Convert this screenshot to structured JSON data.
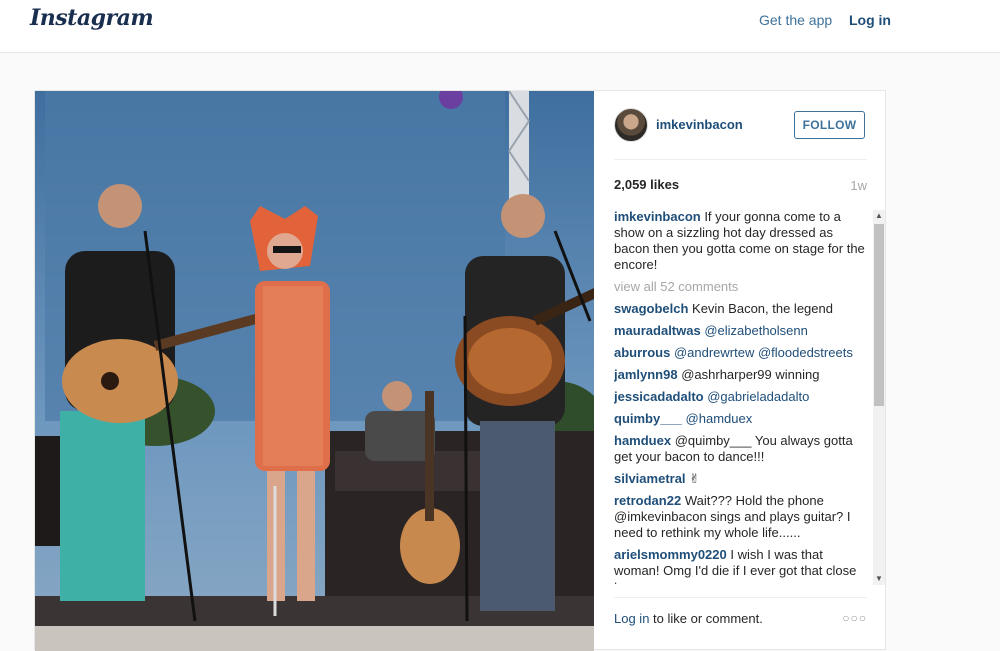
{
  "nav": {
    "logo": "Instagram",
    "get_app": "Get the app",
    "login": "Log in"
  },
  "post": {
    "username": "imkevinbacon",
    "follow_label": "FOLLOW",
    "likes": "2,059 likes",
    "time_ago": "1w",
    "caption": {
      "author": "imkevinbacon",
      "text": " If your gonna come to a show on a sizzling hot day dressed as bacon then you gotta come on stage for the encore!"
    },
    "view_all": "view all 52 comments",
    "comments": [
      {
        "author": "swagobelch",
        "text": " Kevin Bacon, the legend"
      },
      {
        "author": "mauradaltwas",
        "text": " @elizabetholsenn"
      },
      {
        "author": "aburrous",
        "text": " @andrewrtew @floodedstreets"
      },
      {
        "author": "jamlynn98",
        "text": " @ashrharper99 winning"
      },
      {
        "author": "jessicadadalto",
        "text": " @gabrieladadalto"
      },
      {
        "author": "quimby___",
        "text": " @hamduex"
      },
      {
        "author": "hamduex",
        "text": " @quimby___ You always gotta get your bacon to dance!!!"
      },
      {
        "author": "silviametral",
        "text": " ✌"
      },
      {
        "author": "retrodan22",
        "text": " Wait??? Hold the phone @imkevinbacon sings and plays guitar? I need to rethink my whole life......"
      },
      {
        "author": "arielsmommy0220",
        "text": " I wish I was that woman! Omg I'd die if I ever got that close to you"
      }
    ],
    "footer": {
      "login_link": "Log in",
      "suffix": " to like or comment."
    },
    "more_icon": "ellipsis-icon"
  }
}
